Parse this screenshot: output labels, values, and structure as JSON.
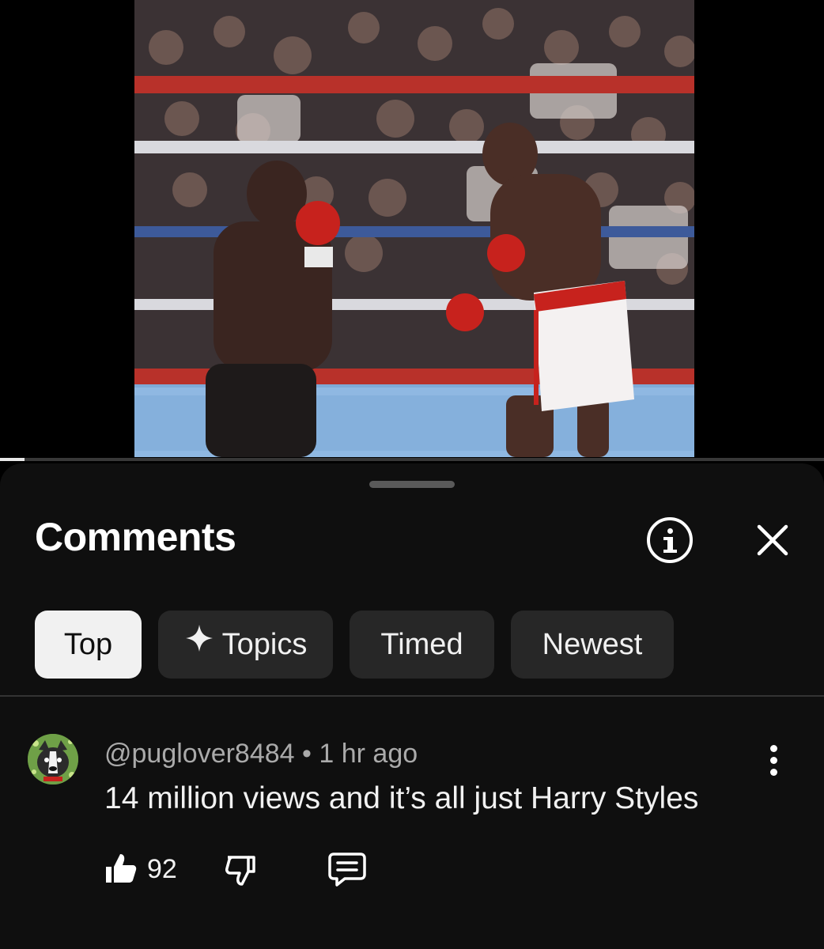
{
  "video": {
    "progress_fraction": 0.03
  },
  "comments_panel": {
    "title": "Comments",
    "info_icon": "info-circle-icon",
    "close_icon": "close-icon",
    "sort_chips": [
      {
        "label": "Top",
        "active": true
      },
      {
        "label": "Topics",
        "icon": "sparkle-icon",
        "active": false
      },
      {
        "label": "Timed",
        "active": false
      },
      {
        "label": "Newest",
        "active": false
      }
    ]
  },
  "comment": {
    "author": "@puglover8484",
    "separator": " • ",
    "time": "1 hr ago",
    "text": "14 million views and it’s all just Harry Styles",
    "like_count": "92",
    "icons": {
      "avatar": "pug-avatar",
      "more": "more-vertical-icon",
      "like": "thumbs-up-icon",
      "dislike": "thumbs-down-icon",
      "reply": "reply-comment-icon"
    }
  },
  "colors": {
    "sheet_background": "#0f0f0f",
    "chip_background": "#272727",
    "chip_active_background": "#f1f1f1",
    "meta_text": "#aaaaaa"
  }
}
